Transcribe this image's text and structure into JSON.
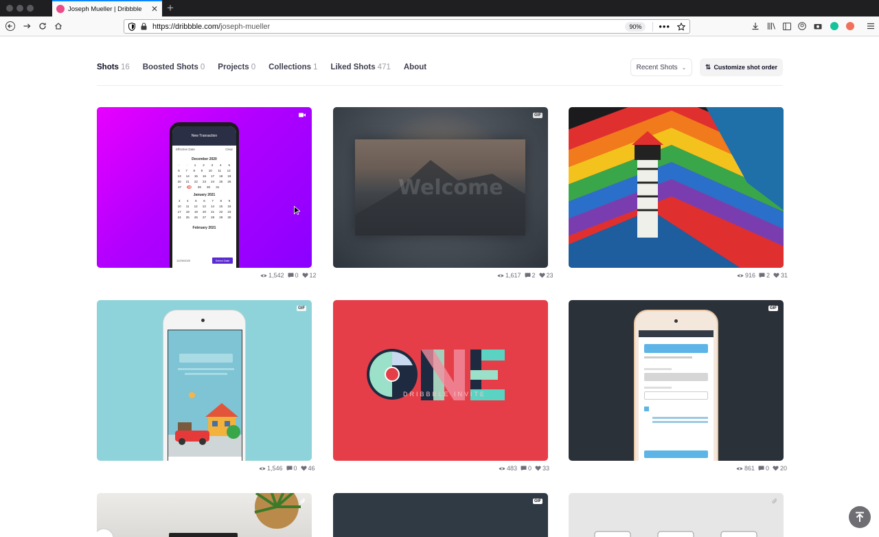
{
  "browser": {
    "tab_title": "Joseph Mueller | Dribbble",
    "url_host": "https://dribbble.com/",
    "url_path": "joseph-mueller",
    "zoom": "90%"
  },
  "profile_nav": {
    "items": [
      {
        "label": "Shots",
        "count": "16"
      },
      {
        "label": "Boosted Shots",
        "count": "0"
      },
      {
        "label": "Projects",
        "count": "0"
      },
      {
        "label": "Collections",
        "count": "1"
      },
      {
        "label": "Liked Shots",
        "count": "471"
      },
      {
        "label": "About",
        "count": ""
      }
    ],
    "sort_label": "Recent Shots",
    "customize_label": "Customize shot order"
  },
  "shots": [
    {
      "views": "1,542",
      "comments": "0",
      "likes": "12",
      "badge": "video-icon"
    },
    {
      "views": "1,617",
      "comments": "2",
      "likes": "23",
      "badge": "GIF"
    },
    {
      "views": "916",
      "comments": "2",
      "likes": "31",
      "badge": ""
    },
    {
      "views": "1,546",
      "comments": "0",
      "likes": "46",
      "badge": "GIF"
    },
    {
      "views": "483",
      "comments": "0",
      "likes": "33",
      "badge": ""
    },
    {
      "views": "861",
      "comments": "0",
      "likes": "20",
      "badge": "GIF"
    },
    {
      "badge": "attachment-icon"
    },
    {
      "badge": "GIF"
    },
    {
      "badge": "attachment-icon"
    }
  ],
  "shot1_screen": {
    "header": "New Transaction",
    "label_date": "Effective Date",
    "clear": "Clear",
    "month1": "December 2020",
    "month2": "January 2021",
    "month3": "February 2021",
    "date_value": "12/29/2020",
    "select": "Select Date"
  },
  "shot2_text": "Welcome",
  "shot5_text": "DRIBBBLE INVITE",
  "colors": {
    "accent": "#ea4c89",
    "link": "#0a84ff"
  }
}
